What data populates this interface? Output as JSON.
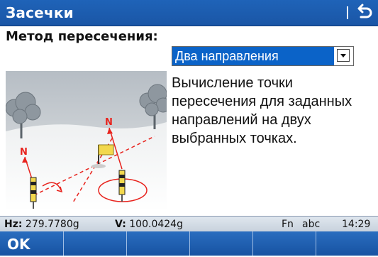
{
  "window": {
    "title": "Засечки"
  },
  "method": {
    "label": "Метод пересечения:",
    "selected": "Два направления"
  },
  "description": "Вычисление точки пересечения для заданных направлений на двух выбранных точках.",
  "illustration": {
    "north_label": "N"
  },
  "status": {
    "hz_label": "Hz:",
    "hz_value": "279.7780g",
    "v_label": "V:",
    "v_value": "100.0424g",
    "fn": "Fn",
    "input_mode": "abc",
    "time": "14:29"
  },
  "softkeys": [
    {
      "label": "OK"
    },
    {
      "label": ""
    },
    {
      "label": ""
    },
    {
      "label": ""
    },
    {
      "label": ""
    },
    {
      "label": ""
    }
  ],
  "colors": {
    "titlebar": "#1a56a6",
    "selection": "#0b63c8",
    "marker_red": "#e8231d"
  }
}
